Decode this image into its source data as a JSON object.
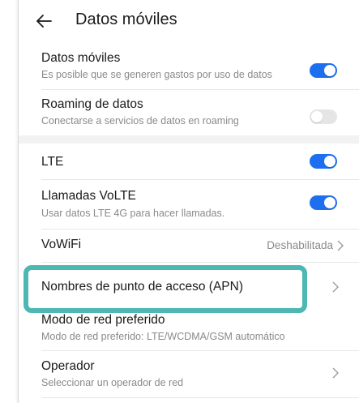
{
  "header": {
    "title": "Datos móviles",
    "back_icon": "arrow-left-icon"
  },
  "colors": {
    "accent": "#1d6ff0",
    "toggle_off": "#e5e5e5",
    "highlight": "#4db8b3",
    "secondary_text": "#8a8a8a"
  },
  "settings": {
    "datos_moviles": {
      "title": "Datos móviles",
      "subtitle": "Es posible que se generen gastos por uso de datos",
      "enabled": true
    },
    "roaming": {
      "title": "Roaming de datos",
      "subtitle": "Conectarse a servicios de datos en roaming",
      "enabled": false
    },
    "lte": {
      "title": "LTE",
      "enabled": true
    },
    "volte": {
      "title": "Llamadas VoLTE",
      "subtitle": "Usar datos LTE 4G para hacer llamadas.",
      "enabled": true
    },
    "vowifi": {
      "title": "VoWiFi",
      "value": "Deshabilitada"
    },
    "apn": {
      "title": "Nombres de punto de acceso (APN)"
    },
    "modo_red": {
      "title": "Modo de red preferido",
      "subtitle": "Modo de red preferido: LTE/WCDMA/GSM automático"
    },
    "operador": {
      "title": "Operador",
      "subtitle": "Seleccionar un operador de red"
    }
  }
}
